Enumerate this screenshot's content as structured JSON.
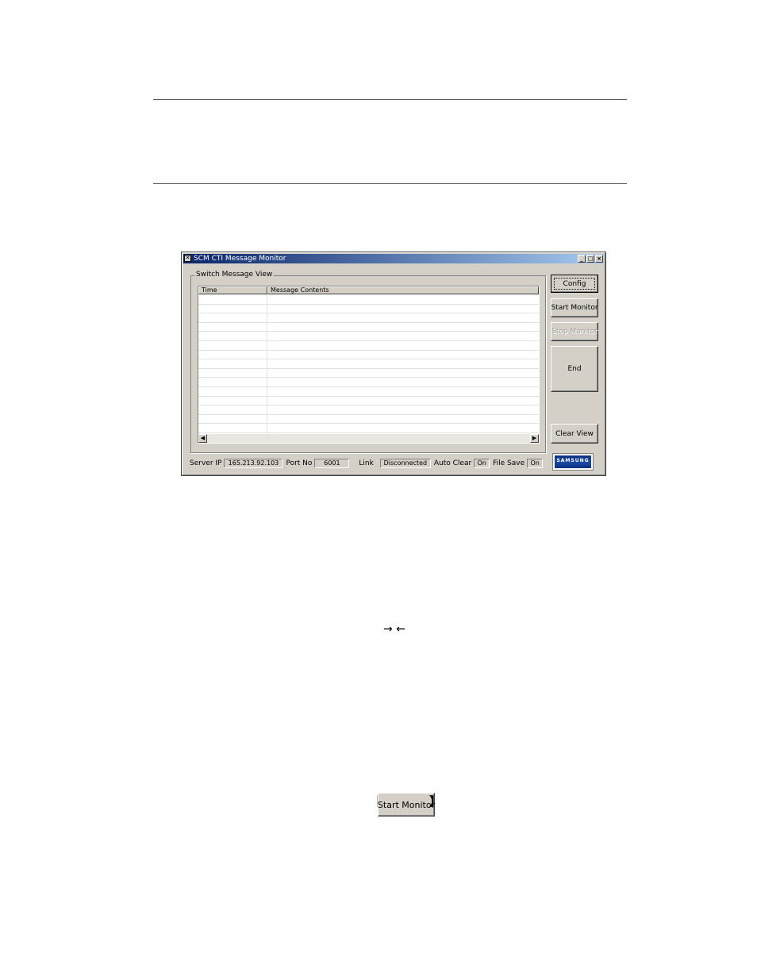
{
  "window": {
    "title": "SCM CTI Message Monitor",
    "controls": {
      "minimize": "_",
      "maximize": "□",
      "close": "×"
    },
    "group_label": "Switch Message View",
    "columns": [
      "Time",
      "Message Contents"
    ],
    "buttons": {
      "config": "Config",
      "start_monitor": "Start Monitor",
      "stop_monitor": "Stop Monitor",
      "end": "End",
      "clear_view": "Clear View"
    },
    "status": {
      "server_ip_label": "Server IP",
      "server_ip": "165.213.92.103",
      "port_label": "Port No",
      "port": "6001",
      "link_label": "Link",
      "link_status": "Disconnected",
      "auto_clear_label": "Auto Clear",
      "auto_clear": "On",
      "file_save_label": "File Save",
      "file_save": "On"
    },
    "logo": "SAMSUNG"
  },
  "body": {
    "arrows": "→ ←",
    "bracket_open": "【",
    "bracket_close": "】",
    "start_monitor_button": "Start Monitor"
  }
}
